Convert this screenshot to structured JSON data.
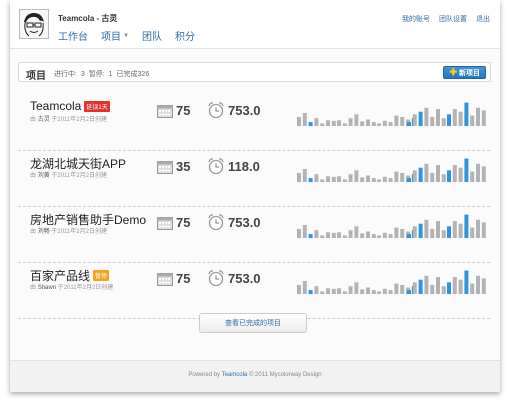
{
  "header": {
    "company": "Teamcola - 古灵",
    "nav": [
      {
        "label": "工作台"
      },
      {
        "label": "项目",
        "dropdown": true
      },
      {
        "label": "团队"
      },
      {
        "label": "积分"
      }
    ],
    "links": [
      "我的账号",
      "团队设置",
      "退出"
    ]
  },
  "project_bar": {
    "title": "项目",
    "in_progress_label": "进行中:",
    "in_progress": "3",
    "paused_label": "暂停:",
    "paused": "1",
    "done_label": "已完成326",
    "new_button": "新项目"
  },
  "projects": [
    {
      "name": "Teamcola",
      "badge": "延误1天",
      "badge_color": "#e1322e",
      "owner_prefix": "由",
      "owner": "古灵",
      "owner_suffix": "于2011年2月2日创建",
      "days": "75",
      "hours": "753.0"
    },
    {
      "name": "龙湖北城天街APP",
      "badge": "",
      "badge_color": "",
      "owner_prefix": "由",
      "owner": "刘黄",
      "owner_suffix": "于2011年2月2日创建",
      "days": "35",
      "hours": "118.0"
    },
    {
      "name": "房地产销售助手Demo",
      "badge": "",
      "badge_color": "",
      "owner_prefix": "由",
      "owner": "刘畅",
      "owner_suffix": "于2011年2月2日创建",
      "days": "75",
      "hours": "753.0"
    },
    {
      "name": "百家产品线",
      "badge": "暂停",
      "badge_color": "#f4a21f",
      "owner_prefix": "由",
      "owner": "Shawn",
      "owner_suffix": "于2011年2月2日创建",
      "days": "75",
      "hours": "753.0"
    }
  ],
  "bar_pattern": [
    [
      0.35,
      0.5,
      0.15,
      0.3,
      0.1,
      0.22,
      0.2
    ],
    [
      0.22,
      0.1,
      0.3,
      0.45,
      0.18,
      0.25,
      0.15
    ],
    [
      0.1,
      0.2,
      0.15,
      0.4,
      0.35,
      0.25,
      0.3
    ],
    [
      0.15,
      0.45,
      0.55,
      0.7,
      0.35,
      0.65,
      0.3
    ],
    [
      0.45,
      0.65,
      0.55,
      0.9,
      0.4,
      0.7,
      0.6
    ]
  ],
  "bar_highlight": [
    [
      0,
      2
    ],
    [
      2,
      6
    ],
    [
      3,
      0
    ],
    [
      3,
      2
    ],
    [
      4,
      0
    ],
    [
      4,
      3
    ]
  ],
  "colors": {
    "bar_blue": "#2f95d8",
    "bar_grey": "#b3b3b3",
    "link": "#2f6ea6"
  },
  "view_completed": "查看已完成的项目",
  "footer": {
    "prefix": "Powered by",
    "brand": "Teamcola",
    "suffix": "© 2011 Mycolorway Design"
  }
}
